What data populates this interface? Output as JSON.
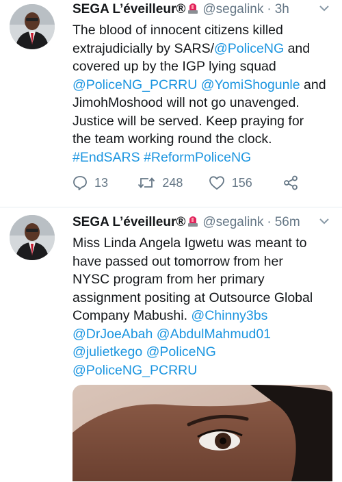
{
  "tweets": [
    {
      "name": "SEGA L’éveilleur®",
      "handle": "@segalink",
      "separator": "·",
      "time": "3h",
      "lines": [
        [
          {
            "t": "The blood of innocent citizens killed",
            "link": false
          }
        ],
        [
          {
            "t": "extrajudicially by SARS/",
            "link": false
          },
          {
            "t": "@PoliceNG",
            "link": true
          },
          {
            "t": " and",
            "link": false
          }
        ],
        [
          {
            "t": "covered up by the IGP lying squad",
            "link": false
          }
        ],
        [
          {
            "t": "@PoliceNG_PCRRU",
            "link": true
          },
          {
            "t": " ",
            "link": false
          },
          {
            "t": "@YomiShogunle",
            "link": true
          },
          {
            "t": " and",
            "link": false
          }
        ],
        [
          {
            "t": "JimohMoshood will not go unavenged.",
            "link": false
          }
        ],
        [
          {
            "t": "Justice will be served. Keep praying for",
            "link": false
          }
        ],
        [
          {
            "t": "the team working round the clock.",
            "link": false
          }
        ],
        [
          {
            "t": "#EndSARS",
            "link": true
          },
          {
            "t": " ",
            "link": false
          },
          {
            "t": "#ReformPoliceNG",
            "link": true
          }
        ]
      ],
      "replies": "13",
      "retweets": "248",
      "likes": "156"
    },
    {
      "name": "SEGA L’éveilleur®",
      "handle": "@segalink",
      "separator": "·",
      "time": "56m",
      "lines": [
        [
          {
            "t": "Miss Linda Angela Igwetu was meant to",
            "link": false
          }
        ],
        [
          {
            "t": "have passed out tomorrow from her",
            "link": false
          }
        ],
        [
          {
            "t": "NYSC program from her primary",
            "link": false
          }
        ],
        [
          {
            "t": "assignment positing at Outsource Global",
            "link": false
          }
        ],
        [
          {
            "t": "Company Mabushi. ",
            "link": false
          },
          {
            "t": "@Chinny3bs",
            "link": true
          }
        ],
        [
          {
            "t": "@DrJoeAbah",
            "link": true
          },
          {
            "t": " ",
            "link": false
          },
          {
            "t": "@AbdulMahmud01",
            "link": true
          }
        ],
        [
          {
            "t": "@julietkego",
            "link": true
          },
          {
            "t": " ",
            "link": false
          },
          {
            "t": "@PoliceNG",
            "link": true
          }
        ],
        [
          {
            "t": "@PoliceNG_PCRRU",
            "link": true
          }
        ]
      ]
    }
  ],
  "icons": {
    "badge": "siren-emoji-icon",
    "menu": "chevron-down-icon",
    "reply": "reply-icon",
    "retweet": "retweet-icon",
    "like": "heart-icon",
    "share": "share-icon"
  },
  "colors": {
    "link": "#1b95e0",
    "text": "#14171a",
    "muted": "#657786",
    "divider": "#e6ecf0",
    "badge_red": "#e0245e"
  }
}
